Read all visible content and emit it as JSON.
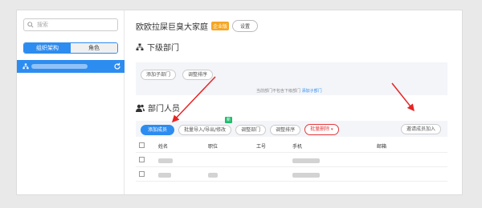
{
  "sidebar": {
    "search_placeholder": "搜索",
    "tabs": [
      "组织架构",
      "角色"
    ]
  },
  "header": {
    "title": "欧欧拉屎巨臭大家庭",
    "badge": "企业版",
    "settings_label": "设置"
  },
  "subdept": {
    "heading": "下级部门",
    "add_label": "添加子部门",
    "sort_label": "调整排序",
    "hint": "当前部门不包含下级部门",
    "hint_link": "添加子部门"
  },
  "members": {
    "heading": "部门人员",
    "add_member": "添加成员",
    "batch_import": "批量导入/导出/修改",
    "new_tag": "新",
    "adjust_dept": "调整部门",
    "adjust_sort": "调整排序",
    "batch_delete": "批量删除",
    "invite": "邀请成员加入",
    "columns": [
      "姓名",
      "职位",
      "工号",
      "手机",
      "邮箱"
    ]
  },
  "colors": {
    "accent": "#2d8cf0",
    "danger": "#e4393c",
    "arrow": "#e82424"
  }
}
